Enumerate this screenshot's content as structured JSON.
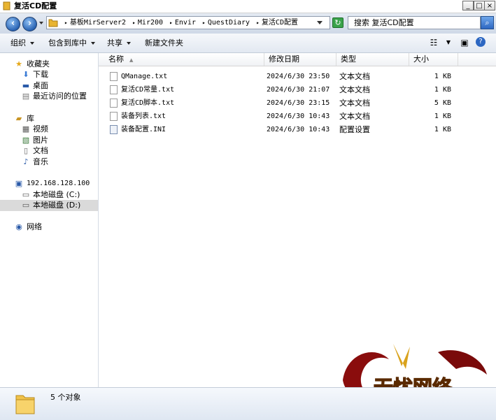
{
  "window": {
    "title": "复活CD配置"
  },
  "address": {
    "crumbs": [
      "基板MirServer2",
      "Mir200",
      "Envir",
      "QuestDiary",
      "复活CD配置"
    ],
    "search_placeholder": "搜索 复活CD配置"
  },
  "toolbar": {
    "organize": "组织",
    "include_in_library": "包含到库中",
    "share": "共享",
    "new_folder": "新建文件夹"
  },
  "nav": {
    "favorites": "收藏夹",
    "downloads": "下载",
    "desktop": "桌面",
    "recent": "最近访问的位置",
    "libraries": "库",
    "videos": "视频",
    "pictures": "图片",
    "documents": "文档",
    "music": "音乐",
    "computer": "192.168.128.100",
    "drive_c": "本地磁盘 (C:)",
    "drive_d": "本地磁盘 (D:)",
    "network": "网络"
  },
  "columns": {
    "name": "名称",
    "modified": "修改日期",
    "type": "类型",
    "size": "大小"
  },
  "files": [
    {
      "name": "QManage.txt",
      "modified": "2024/6/30 23:50",
      "type": "文本文档",
      "size": "1 KB"
    },
    {
      "name": "复活CD常量.txt",
      "modified": "2024/6/30 21:07",
      "type": "文本文档",
      "size": "1 KB"
    },
    {
      "name": "复活CD脚本.txt",
      "modified": "2024/6/30 23:15",
      "type": "文本文档",
      "size": "5 KB"
    },
    {
      "name": "装备列表.txt",
      "modified": "2024/6/30 10:43",
      "type": "文本文档",
      "size": "1 KB"
    },
    {
      "name": "装备配置.INI",
      "modified": "2024/6/30 10:43",
      "type": "配置设置",
      "size": "1 KB"
    }
  ],
  "status": {
    "count": "5 个对象"
  },
  "watermark": {
    "brand": "无忧网络"
  }
}
